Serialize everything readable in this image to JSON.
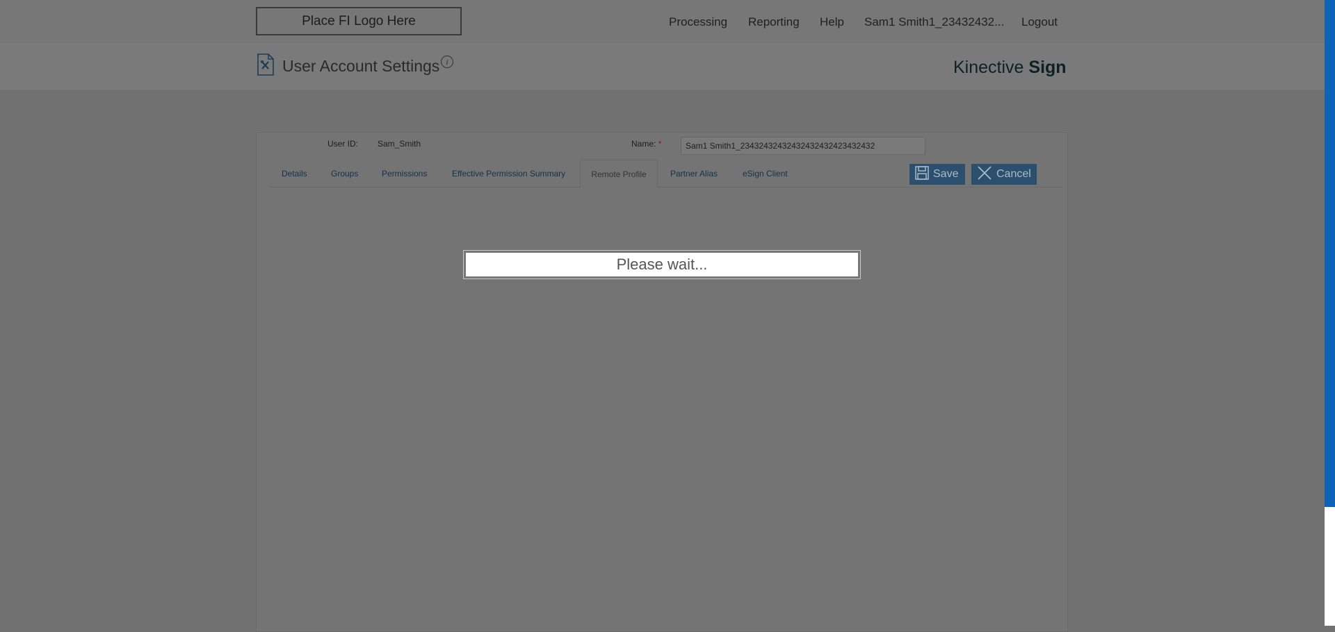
{
  "header": {
    "logo_text": "Place FI Logo Here",
    "nav": {
      "processing": "Processing",
      "reporting": "Reporting",
      "help": "Help",
      "user": "Sam1 Smith1_23432432...",
      "logout": "Logout"
    }
  },
  "page": {
    "title": "User Account Settings",
    "info_glyph": "i",
    "brand_light": "Kinective ",
    "brand_bold": "Sign"
  },
  "form": {
    "user_id_label": "User ID:",
    "user_id_value": "Sam_Smith",
    "name_label": "Name:",
    "required_marker": "*",
    "name_value": "Sam1 Smith1_23432432432432432432423432432"
  },
  "tabs": {
    "details": "Details",
    "groups": "Groups",
    "permissions": "Permissions",
    "effective": "Effective Permission Summary",
    "remote": "Remote Profile",
    "partner": "Partner Alias",
    "esign": "eSign Client"
  },
  "buttons": {
    "save": "Save",
    "cancel": "Cancel"
  },
  "overlay": {
    "message": "Please wait..."
  },
  "colors": {
    "accent_button": "#2c4f6d",
    "scrollbar_thumb": "#0d63b8"
  },
  "icons": [
    "document-settings-icon",
    "info-icon",
    "save-disk-icon",
    "close-x-icon"
  ]
}
